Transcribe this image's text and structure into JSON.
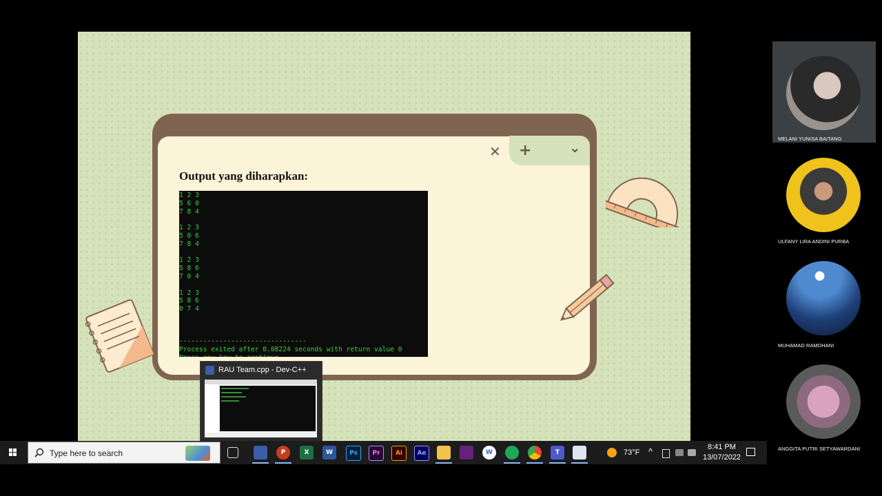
{
  "slide": {
    "heading": "Output yang diharapkan:",
    "console_lines": [
      "1 2 3",
      "5 6 0",
      "7 8 4",
      "",
      "1 2 3",
      "5 0 6",
      "7 8 4",
      "",
      "1 2 3",
      "5 8 6",
      "7 0 4",
      "",
      "1 2 3",
      "5 8 6",
      "0 7 4",
      "",
      "",
      "",
      "--------------------------------",
      "Process exited after 0.08224 seconds with return value 0",
      "Press any key to continue . . . "
    ],
    "controls": {
      "close": "✕",
      "add": "+",
      "more": "⌄"
    },
    "colors": {
      "slide_bg": "#d6e2ba",
      "frame": "#7f6551",
      "panel": "#fbf4d8",
      "console_text": "#3ecf3e"
    }
  },
  "thumbnail": {
    "title": "RAU Team.cpp - Dev-C++",
    "app_icon": "devcpp-icon"
  },
  "participants": [
    {
      "name": "MELANI YUNISA BAITANG"
    },
    {
      "name": "ULFANY LIRA ANDINI PURBA"
    },
    {
      "name": "MUHAMAD RAMDHANI"
    },
    {
      "name": "ANGGITA PUTRI SETYAWARDANI"
    }
  ],
  "taskbar": {
    "search_placeholder": "Type here to search",
    "apps": [
      {
        "icon": "task-view-icon",
        "label": ""
      },
      {
        "icon": "devcpp-icon",
        "label": ""
      },
      {
        "icon": "powerpoint-icon",
        "label": "P"
      },
      {
        "icon": "excel-icon",
        "label": "X"
      },
      {
        "icon": "word-icon",
        "label": "W"
      },
      {
        "icon": "photoshop-icon",
        "label": "Ps"
      },
      {
        "icon": "premiere-icon",
        "label": "Pr"
      },
      {
        "icon": "illustrator-icon",
        "label": "Ai"
      },
      {
        "icon": "after-effects-icon",
        "label": "Ae"
      },
      {
        "icon": "file-explorer-icon",
        "label": ""
      },
      {
        "icon": "visual-studio-icon",
        "label": ""
      },
      {
        "icon": "wps-icon",
        "label": "W"
      },
      {
        "icon": "record-app-icon",
        "label": ""
      },
      {
        "icon": "chrome-icon",
        "label": ""
      },
      {
        "icon": "teams-icon",
        "label": "T"
      },
      {
        "icon": "window-app-icon",
        "label": ""
      }
    ],
    "weather": "73°F",
    "time": "8:41 PM",
    "date": "13/07/2022"
  }
}
